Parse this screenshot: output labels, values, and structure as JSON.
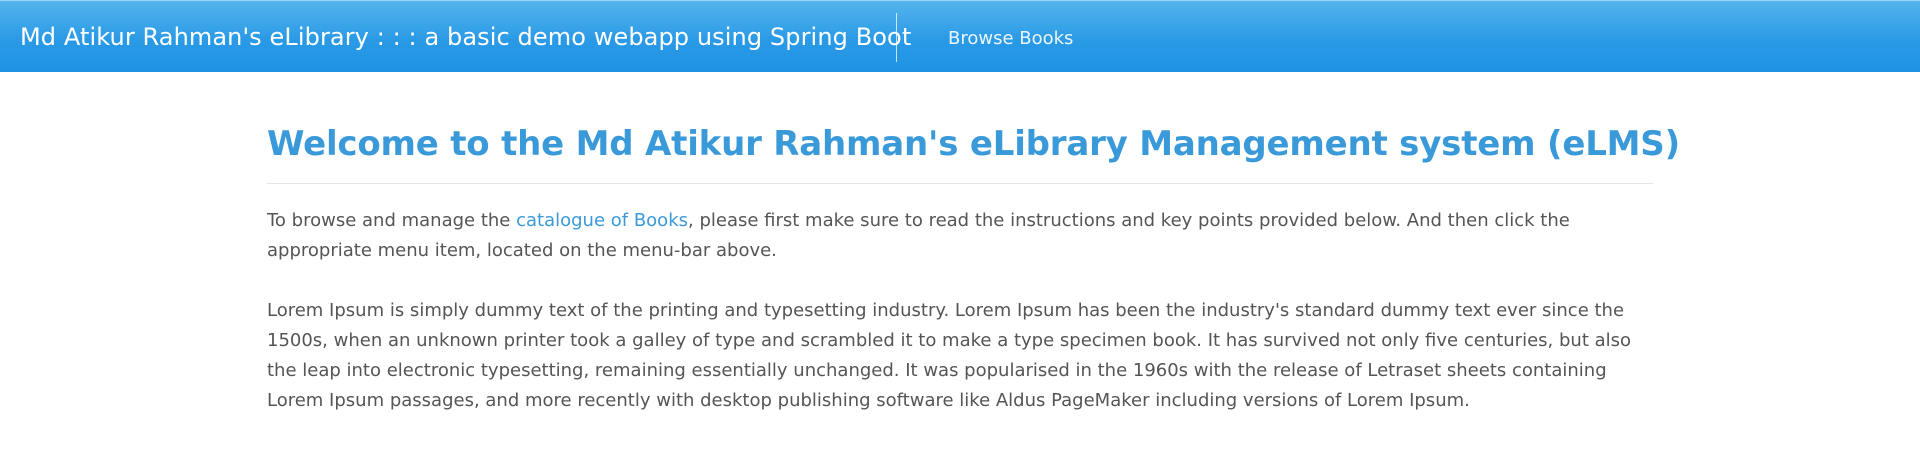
{
  "navbar": {
    "brand": "Md Atikur Rahman's eLibrary : : : a basic demo webapp using Spring Boot",
    "links": [
      {
        "label": "Browse Books"
      }
    ]
  },
  "main": {
    "title": "Welcome to the Md Atikur Rahman's eLibrary Management system (eLMS)",
    "intro": {
      "before_link": "To browse and manage the ",
      "link_text": "catalogue of Books",
      "after_link": ", please first make sure to read the instructions and key points provided below. And then click the appropriate menu item, located on the menu-bar above."
    },
    "lorem": "Lorem Ipsum is simply dummy text of the printing and typesetting industry. Lorem Ipsum has been the industry's standard dummy text ever since the 1500s, when an unknown printer took a galley of type and scrambled it to make a type specimen book. It has survived not only five centuries, but also the leap into electronic typesetting, remaining essentially unchanged. It was popularised in the 1960s with the release of Letraset sheets containing Lorem Ipsum passages, and more recently with desktop publishing software like Aldus PageMaker including versions of Lorem Ipsum."
  },
  "colors": {
    "navbar_top": "#53b4ec",
    "navbar_bottom": "#1f93e3",
    "title": "#3a9ad9",
    "link": "#3a9ad9",
    "body_text": "#555555"
  }
}
